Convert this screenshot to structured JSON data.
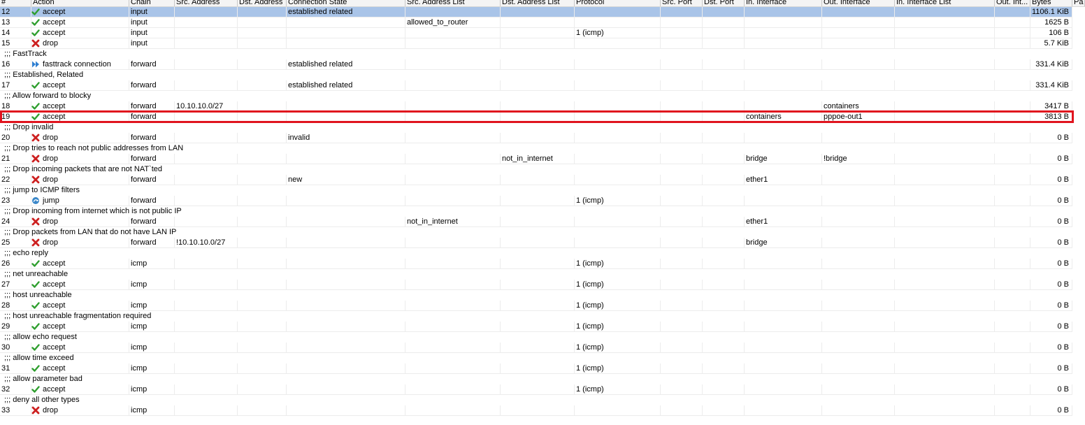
{
  "colors": {
    "selected_row": "#a9c4e8",
    "highlight_border": "#e0141e",
    "accept": "#2e9e2e",
    "drop": "#cc1f1f",
    "fasttrack": "#2f7fd1",
    "jump": "#3a87c9"
  },
  "columns": [
    {
      "key": "num",
      "label": "#"
    },
    {
      "key": "action",
      "label": "Action"
    },
    {
      "key": "chain",
      "label": "Chain"
    },
    {
      "key": "src",
      "label": "Src. Address"
    },
    {
      "key": "dst",
      "label": "Dst. Address"
    },
    {
      "key": "state",
      "label": "Connection State"
    },
    {
      "key": "srclist",
      "label": "Src. Address List"
    },
    {
      "key": "dstlist",
      "label": "Dst. Address List"
    },
    {
      "key": "proto",
      "label": "Protocol"
    },
    {
      "key": "sport",
      "label": "Src. Port"
    },
    {
      "key": "dport",
      "label": "Dst. Port"
    },
    {
      "key": "inif",
      "label": "In. Interface"
    },
    {
      "key": "outif",
      "label": "Out. Interface"
    },
    {
      "key": "iniflist",
      "label": "In. Interface List"
    },
    {
      "key": "outint",
      "label": "Out. Int..."
    },
    {
      "key": "bytes",
      "label": "Bytes"
    },
    {
      "key": "pa",
      "label": "Pa"
    }
  ],
  "rows": [
    {
      "type": "rule",
      "num": "12",
      "icon": "accept",
      "action": "accept",
      "chain": "input",
      "state": "established related",
      "bytes": "1106.1 KiB",
      "selected": true
    },
    {
      "type": "rule",
      "num": "13",
      "icon": "accept",
      "action": "accept",
      "chain": "input",
      "srclist": "allowed_to_router",
      "bytes": "1625 B"
    },
    {
      "type": "rule",
      "num": "14",
      "icon": "accept",
      "action": "accept",
      "chain": "input",
      "proto": "1 (icmp)",
      "bytes": "106 B"
    },
    {
      "type": "rule",
      "num": "15",
      "icon": "drop",
      "action": "drop",
      "chain": "input",
      "bytes": "5.7 KiB"
    },
    {
      "type": "comment",
      "text": ";;; FastTrack"
    },
    {
      "type": "rule",
      "num": "16",
      "icon": "fasttrack",
      "action": "fasttrack connection",
      "chain": "forward",
      "state": "established related",
      "bytes": "331.4 KiB"
    },
    {
      "type": "comment",
      "text": ";;; Established, Related"
    },
    {
      "type": "rule",
      "num": "17",
      "icon": "accept",
      "action": "accept",
      "chain": "forward",
      "state": "established related",
      "bytes": "331.4 KiB"
    },
    {
      "type": "comment",
      "text": ";;; Allow forward to blocky"
    },
    {
      "type": "rule",
      "num": "18",
      "icon": "accept",
      "action": "accept",
      "chain": "forward",
      "src": "10.10.10.0/27",
      "outif": "containers",
      "bytes": "3417 B"
    },
    {
      "type": "rule",
      "num": "19",
      "icon": "accept",
      "action": "accept",
      "chain": "forward",
      "inif": "containers",
      "outif": "pppoe-out1",
      "bytes": "3813 B"
    },
    {
      "type": "comment",
      "text": ";;; Drop invalid"
    },
    {
      "type": "rule",
      "num": "20",
      "icon": "drop",
      "action": "drop",
      "chain": "forward",
      "state": "invalid",
      "bytes": "0 B"
    },
    {
      "type": "comment",
      "text": ";;; Drop tries to reach not public addresses from LAN"
    },
    {
      "type": "rule",
      "num": "21",
      "icon": "drop",
      "action": "drop",
      "chain": "forward",
      "dstlist": "not_in_internet",
      "inif": "bridge",
      "outif": "!bridge",
      "bytes": "0 B"
    },
    {
      "type": "comment",
      "text": ";;; Drop incoming packets that are not NAT`ted"
    },
    {
      "type": "rule",
      "num": "22",
      "icon": "drop",
      "action": "drop",
      "chain": "forward",
      "state": "new",
      "inif": "ether1",
      "bytes": "0 B"
    },
    {
      "type": "comment",
      "text": ";;; jump to ICMP filters"
    },
    {
      "type": "rule",
      "num": "23",
      "icon": "jump",
      "action": "jump",
      "chain": "forward",
      "proto": "1 (icmp)",
      "bytes": "0 B"
    },
    {
      "type": "comment",
      "text": ";;; Drop incoming from internet which is not public IP"
    },
    {
      "type": "rule",
      "num": "24",
      "icon": "drop",
      "action": "drop",
      "chain": "forward",
      "srclist": "not_in_internet",
      "inif": "ether1",
      "bytes": "0 B"
    },
    {
      "type": "comment",
      "text": ";;; Drop packets from LAN that do not have LAN IP"
    },
    {
      "type": "rule",
      "num": "25",
      "icon": "drop",
      "action": "drop",
      "chain": "forward",
      "src": "!10.10.10.0/27",
      "inif": "bridge",
      "bytes": "0 B"
    },
    {
      "type": "comment",
      "text": ";;; echo reply"
    },
    {
      "type": "rule",
      "num": "26",
      "icon": "accept",
      "action": "accept",
      "chain": "icmp",
      "proto": "1 (icmp)",
      "bytes": "0 B"
    },
    {
      "type": "comment",
      "text": ";;; net unreachable"
    },
    {
      "type": "rule",
      "num": "27",
      "icon": "accept",
      "action": "accept",
      "chain": "icmp",
      "proto": "1 (icmp)",
      "bytes": "0 B"
    },
    {
      "type": "comment",
      "text": ";;; host unreachable"
    },
    {
      "type": "rule",
      "num": "28",
      "icon": "accept",
      "action": "accept",
      "chain": "icmp",
      "proto": "1 (icmp)",
      "bytes": "0 B"
    },
    {
      "type": "comment",
      "text": ";;; host unreachable fragmentation required"
    },
    {
      "type": "rule",
      "num": "29",
      "icon": "accept",
      "action": "accept",
      "chain": "icmp",
      "proto": "1 (icmp)",
      "bytes": "0 B"
    },
    {
      "type": "comment",
      "text": ";;; allow echo request"
    },
    {
      "type": "rule",
      "num": "30",
      "icon": "accept",
      "action": "accept",
      "chain": "icmp",
      "proto": "1 (icmp)",
      "bytes": "0 B"
    },
    {
      "type": "comment",
      "text": ";;; allow time exceed"
    },
    {
      "type": "rule",
      "num": "31",
      "icon": "accept",
      "action": "accept",
      "chain": "icmp",
      "proto": "1 (icmp)",
      "bytes": "0 B"
    },
    {
      "type": "comment",
      "text": ";;; allow parameter bad"
    },
    {
      "type": "rule",
      "num": "32",
      "icon": "accept",
      "action": "accept",
      "chain": "icmp",
      "proto": "1 (icmp)",
      "bytes": "0 B"
    },
    {
      "type": "comment",
      "text": ";;; deny all other types"
    },
    {
      "type": "rule",
      "num": "33",
      "icon": "drop",
      "action": "drop",
      "chain": "icmp",
      "bytes": "0 B"
    }
  ]
}
